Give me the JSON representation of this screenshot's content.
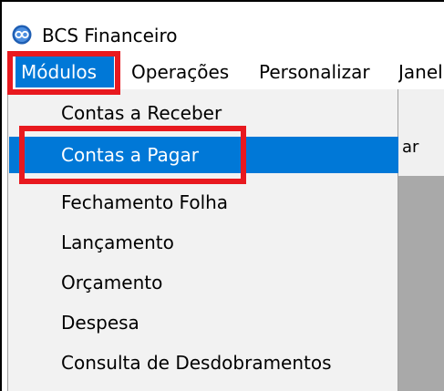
{
  "window": {
    "title": "BCS Financeiro",
    "icon": "bcs-app-icon"
  },
  "menubar": {
    "items": [
      {
        "label": "Módulos"
      },
      {
        "label": "Operações"
      },
      {
        "label": "Personalizar"
      },
      {
        "label": "Janel"
      }
    ]
  },
  "dropdown": {
    "items": [
      {
        "label": "Contas a Receber"
      },
      {
        "label": "Contas a Pagar"
      },
      {
        "label": "Fechamento Folha"
      },
      {
        "label": "Lançamento"
      },
      {
        "label": "Orçamento"
      },
      {
        "label": "Despesa"
      },
      {
        "label": "Consulta de Desdobramentos"
      }
    ]
  },
  "background": {
    "partial_label": "ar"
  },
  "colors": {
    "selection": "#0078d7",
    "highlight_annotation": "#e8191f",
    "menu_bg": "#f2f2f2"
  }
}
